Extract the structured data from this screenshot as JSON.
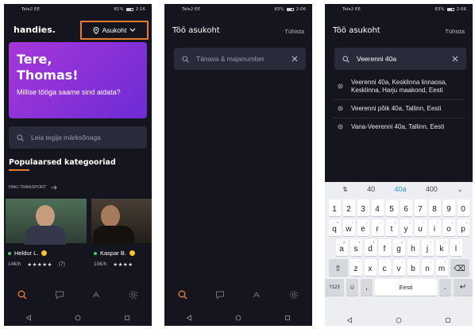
{
  "status": {
    "s1": {
      "carrier": "Tele2 EE",
      "battery": "81%",
      "time": "2:16"
    },
    "s2": {
      "carrier": "Tele2 EE",
      "battery": "83%",
      "time": "2:06"
    },
    "s3": {
      "carrier": "Tele2 EE",
      "battery": "83%",
      "time": "2:06"
    }
  },
  "home": {
    "logo": "handies.",
    "location_button": "Asukoht",
    "greeting_line1": "Tere,",
    "greeting_line2": "Thomas!",
    "greeting_question": "Millise tööga saame sind aidata?",
    "search_placeholder": "Leia tegija märksõnaga",
    "section_title": "Populaarsed kategooriad",
    "category": "PAKI TRANSPORT",
    "cards": [
      {
        "name": "Heldur L.",
        "price": "14€/h",
        "stars": "★★★★★",
        "reviews": "(7)"
      },
      {
        "name": "Kaspar B.",
        "price": "10€/h",
        "stars": "★★★★"
      }
    ]
  },
  "location": {
    "title": "Töö asukoht",
    "cancel": "Tühista",
    "placeholder": "Tänava & majanumber",
    "query": "Veerenni 40a",
    "results": [
      "Veerenni 40a, Kesklinna linnaosa, Kesklinna, Harju maakond, Eesti",
      "Veerenni põik 40a, Tallinn, Eesti",
      "Vana-Veerenni 40a, Tallinn, Eesti"
    ]
  },
  "keyboard": {
    "suggestions": [
      "40",
      "40a",
      "400"
    ],
    "row_numbers": [
      "1",
      "2",
      "3",
      "4",
      "5",
      "6",
      "7",
      "8",
      "9",
      "0"
    ],
    "row1": [
      "q",
      "w",
      "e",
      "r",
      "t",
      "y",
      "u",
      "i",
      "o",
      "p"
    ],
    "row1_alt": [
      "%",
      "\\",
      "|",
      "=",
      "[",
      "]",
      "<",
      ">",
      "{",
      "}"
    ],
    "row2": [
      "a",
      "s",
      "d",
      "f",
      "g",
      "h",
      "j",
      "k",
      "l"
    ],
    "row2_alt": [
      "@",
      "#",
      "$",
      "_",
      "&",
      "-",
      "+",
      "(",
      ")"
    ],
    "row3": [
      "z",
      "x",
      "c",
      "v",
      "b",
      "n",
      "m"
    ],
    "row3_alt": [
      "*",
      "\"",
      "'",
      ":",
      ";",
      "!",
      "?"
    ],
    "space_label": "Eesti",
    "symbols_label": "?123"
  },
  "colors": {
    "accent": "#e77b2d",
    "background": "#15151f",
    "promo": "#8a33d8"
  },
  "icons": {
    "nav": [
      "search-icon",
      "chat-icon",
      "handshake-icon",
      "settings-icon"
    ],
    "sys": [
      "back-triangle-icon",
      "home-circle-icon",
      "recents-square-icon"
    ]
  }
}
